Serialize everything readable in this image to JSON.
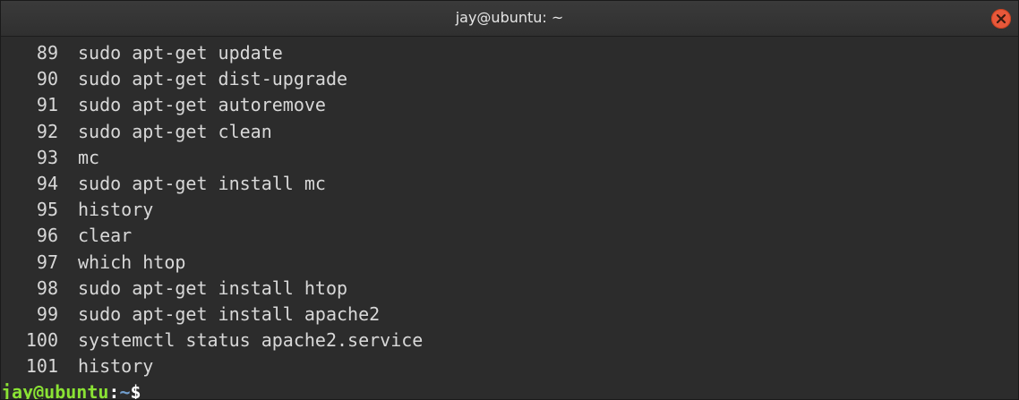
{
  "window": {
    "title": "jay@ubuntu: ~"
  },
  "terminal": {
    "history": [
      {
        "num": "89",
        "cmd": "sudo apt-get update"
      },
      {
        "num": "90",
        "cmd": "sudo apt-get dist-upgrade"
      },
      {
        "num": "91",
        "cmd": "sudo apt-get autoremove"
      },
      {
        "num": "92",
        "cmd": "sudo apt-get clean"
      },
      {
        "num": "93",
        "cmd": "mc"
      },
      {
        "num": "94",
        "cmd": "sudo apt-get install mc"
      },
      {
        "num": "95",
        "cmd": "history"
      },
      {
        "num": "96",
        "cmd": "clear"
      },
      {
        "num": "97",
        "cmd": "which htop"
      },
      {
        "num": "98",
        "cmd": "sudo apt-get install htop"
      },
      {
        "num": "99",
        "cmd": "sudo apt-get install apache2"
      },
      {
        "num": "100",
        "cmd": "systemctl status apache2.service"
      },
      {
        "num": "101",
        "cmd": "history"
      }
    ],
    "prompt": {
      "user_host": "jay@ubuntu",
      "separator": ":",
      "path": "~",
      "symbol": "$"
    }
  },
  "colors": {
    "background": "#2c2c2c",
    "text": "#d8d8d8",
    "prompt_user": "#8ae234",
    "prompt_path": "#729fcf",
    "close_button": "#e8583a"
  },
  "icons": {
    "close": "close-icon"
  }
}
